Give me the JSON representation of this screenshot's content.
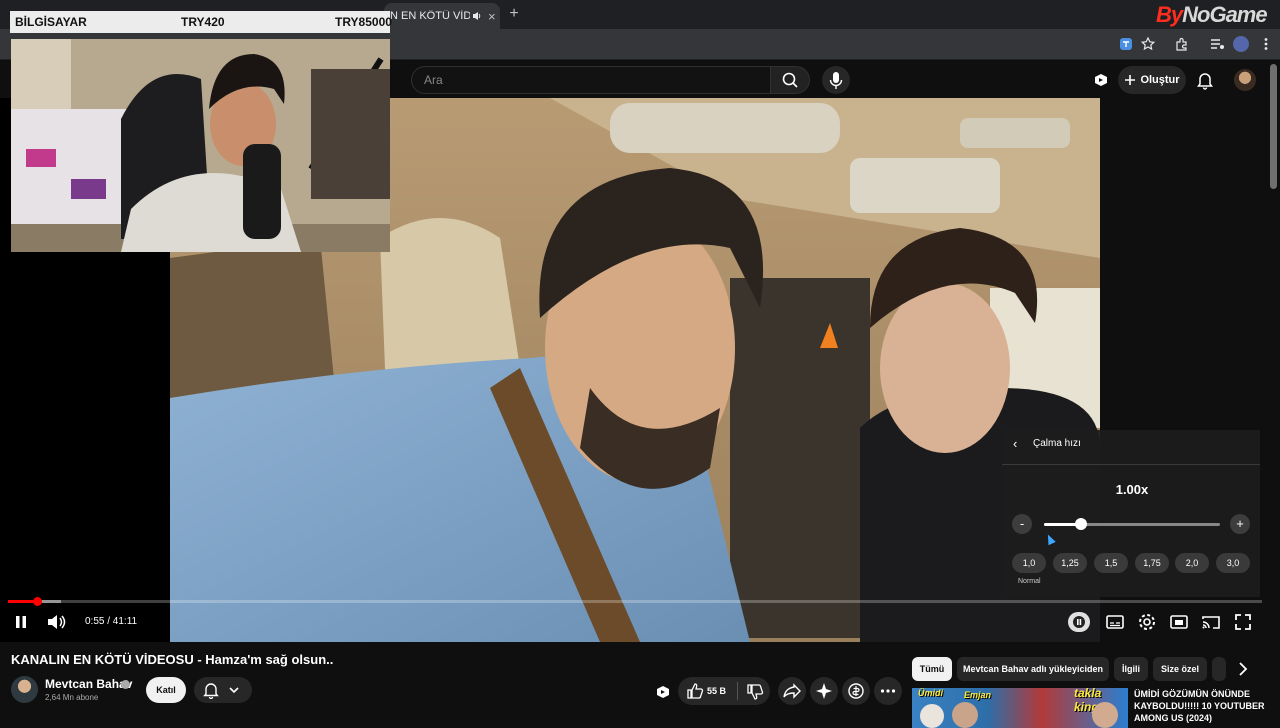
{
  "browser": {
    "tab_title": "KANALIN EN KÖTÜ VİDEOSU - Hamza'm sağ olsun.. - YouTube",
    "tab_title_visible": "N EN KÖTÜ VİDEOS",
    "new_tab": "+",
    "watermark_left": "By",
    "watermark_right": "NoGame"
  },
  "youtube": {
    "search_placeholder": "Ara",
    "create_label": "Oluştur"
  },
  "overlay": {
    "label_left": "BİLGİSAYAR",
    "label_mid": "TRY420",
    "label_right": "TRY85000"
  },
  "player": {
    "current_time": "0:55",
    "duration": "41:11",
    "time_text": "0:55 / 41:11",
    "progress_fraction": 0.023,
    "buffered_fraction": 0.042,
    "speed_panel": {
      "title": "Çalma hızı",
      "value": "1.00x",
      "slider_fraction": 0.21,
      "minus": "-",
      "plus": "+",
      "presets": [
        "1,0",
        "1,25",
        "1,5",
        "1,75",
        "2,0",
        "3,0"
      ],
      "normal_label": "Normal"
    }
  },
  "video": {
    "title": "KANALIN EN KÖTÜ VİDEOSU - Hamza'm sağ olsun..",
    "channel": "Mevtcan Bahav",
    "subscribers": "2,64 Mn abone",
    "join_label": "Katıl",
    "likes": "55 B"
  },
  "sidebar": {
    "chips": [
      "Tümü",
      "Mevtcan Bahav adlı yükleyiciden",
      "İlgili",
      "Size özel"
    ],
    "rec": {
      "title": "ÜMİDİ GÖZÜMÜN ÖNÜNDE KAYBOLDU!!!!! 10 YOUTUBER AMONG US (2024)",
      "thumb_text_1": "Ümidi",
      "thumb_text_2": "Emjan",
      "thumb_text_3": "takla king"
    }
  },
  "colors": {
    "accent": "#ff0000",
    "background": "#0f0f0f",
    "chip_bg": "#272727"
  }
}
